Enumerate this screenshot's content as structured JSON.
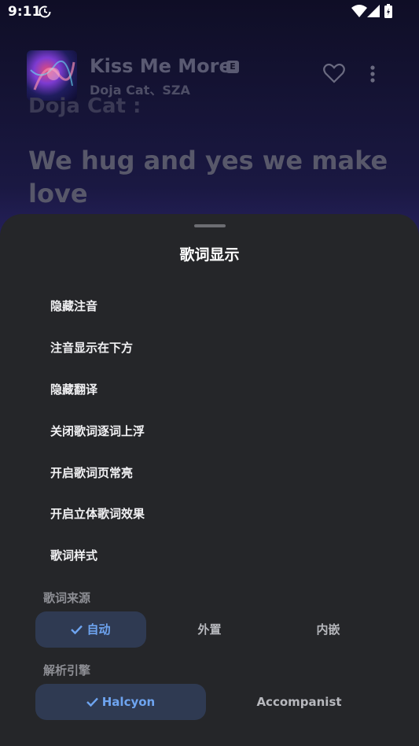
{
  "status_bar": {
    "time": "9:11"
  },
  "player": {
    "title": "Kiss Me More",
    "explicit_badge": "E",
    "artist": "Doja Cat、SZA",
    "lyric_previous": "Doja Cat :",
    "lyric_current": "We hug and yes we make love"
  },
  "sheet": {
    "title": "歌词显示",
    "options": [
      {
        "label": "隐藏注音"
      },
      {
        "label": "注音显示在下方"
      },
      {
        "label": "隐藏翻译"
      },
      {
        "label": "关闭歌词逐词上浮"
      },
      {
        "label": "开启歌词页常亮"
      },
      {
        "label": "开启立体歌词效果"
      },
      {
        "label": "歌词样式"
      }
    ],
    "lyrics_source": {
      "label": "歌词来源",
      "options": [
        "自动",
        "外置",
        "内嵌"
      ],
      "selected": "自动"
    },
    "parse_engine": {
      "label": "解析引擎",
      "options": [
        "Halcyon",
        "Accompanist"
      ],
      "selected": "Halcyon"
    }
  },
  "colors": {
    "sheet_bg": "#252629",
    "accent": "#6ea4f0",
    "selected_bg": "#2f3a52"
  }
}
